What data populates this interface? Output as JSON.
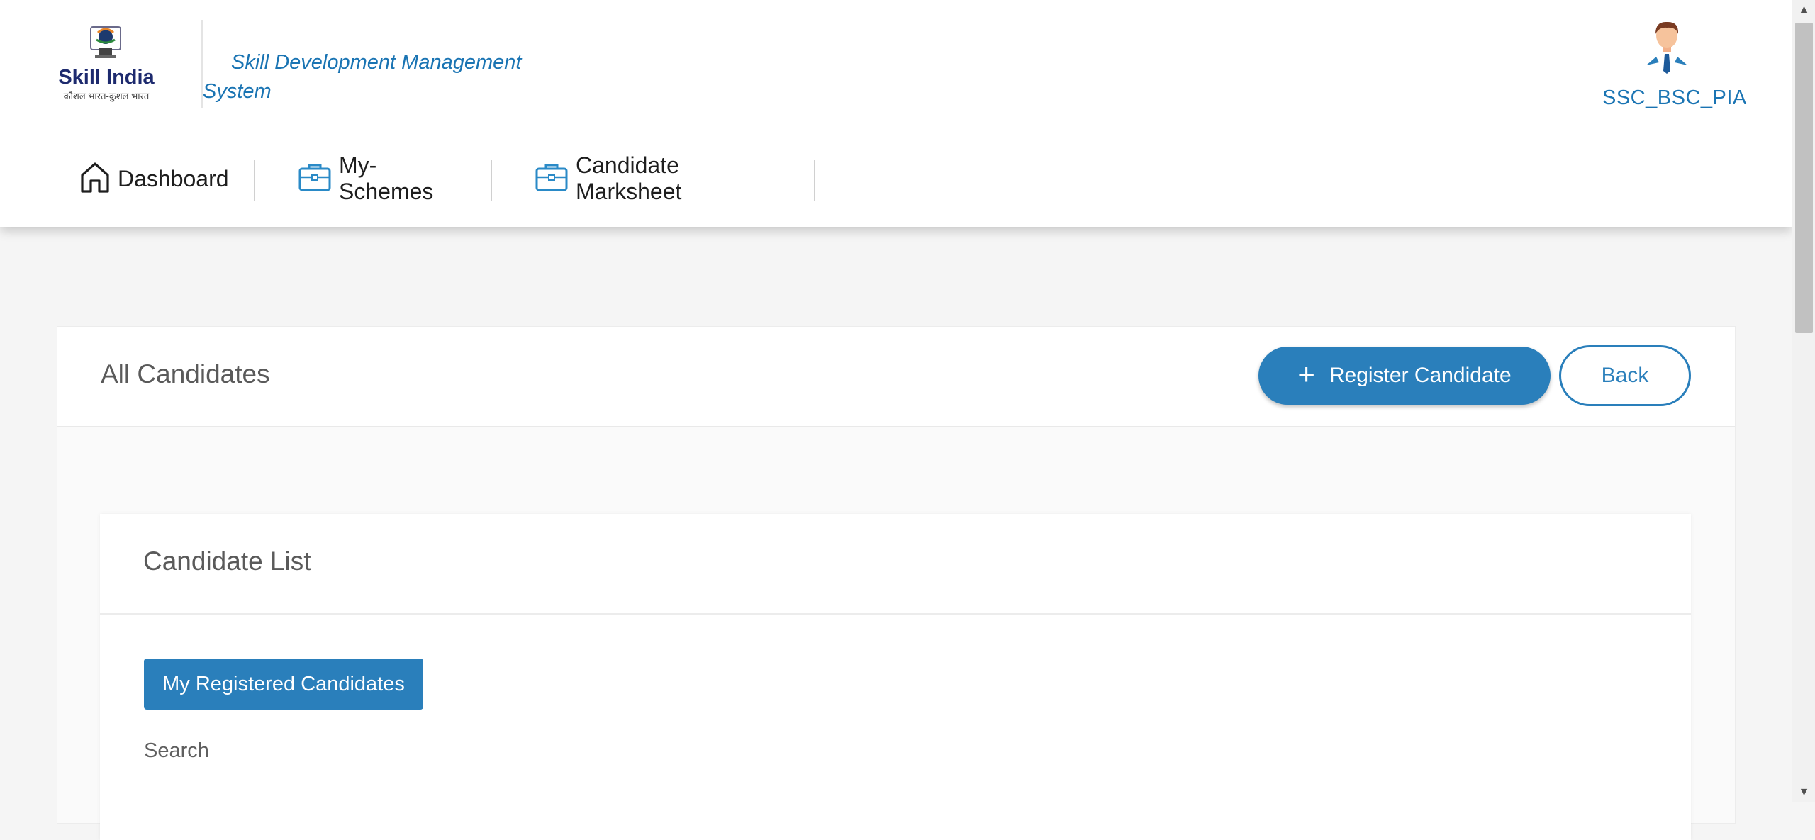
{
  "header": {
    "logo_alt": "Skill India",
    "logo_text_main": "Skill India",
    "logo_text_sub": "कौशल भारत-कुशल भारत",
    "system_title": "Skill Development Management System",
    "user_name": "SSC_BSC_PIA"
  },
  "nav": {
    "items": [
      {
        "label": "Dashboard",
        "icon": "home-icon"
      },
      {
        "label": "My-Schemes",
        "icon": "briefcase-icon"
      },
      {
        "label": "Candidate Marksheet",
        "icon": "briefcase-icon"
      }
    ]
  },
  "page": {
    "title": "All Candidates",
    "register_label": "Register Candidate",
    "back_label": "Back"
  },
  "candidate_list": {
    "title": "Candidate List",
    "my_registered_label": "My Registered Candidates",
    "search_label": "Search"
  },
  "colors": {
    "brand_blue": "#2a7fbb",
    "title_blue": "#1a74b3"
  }
}
